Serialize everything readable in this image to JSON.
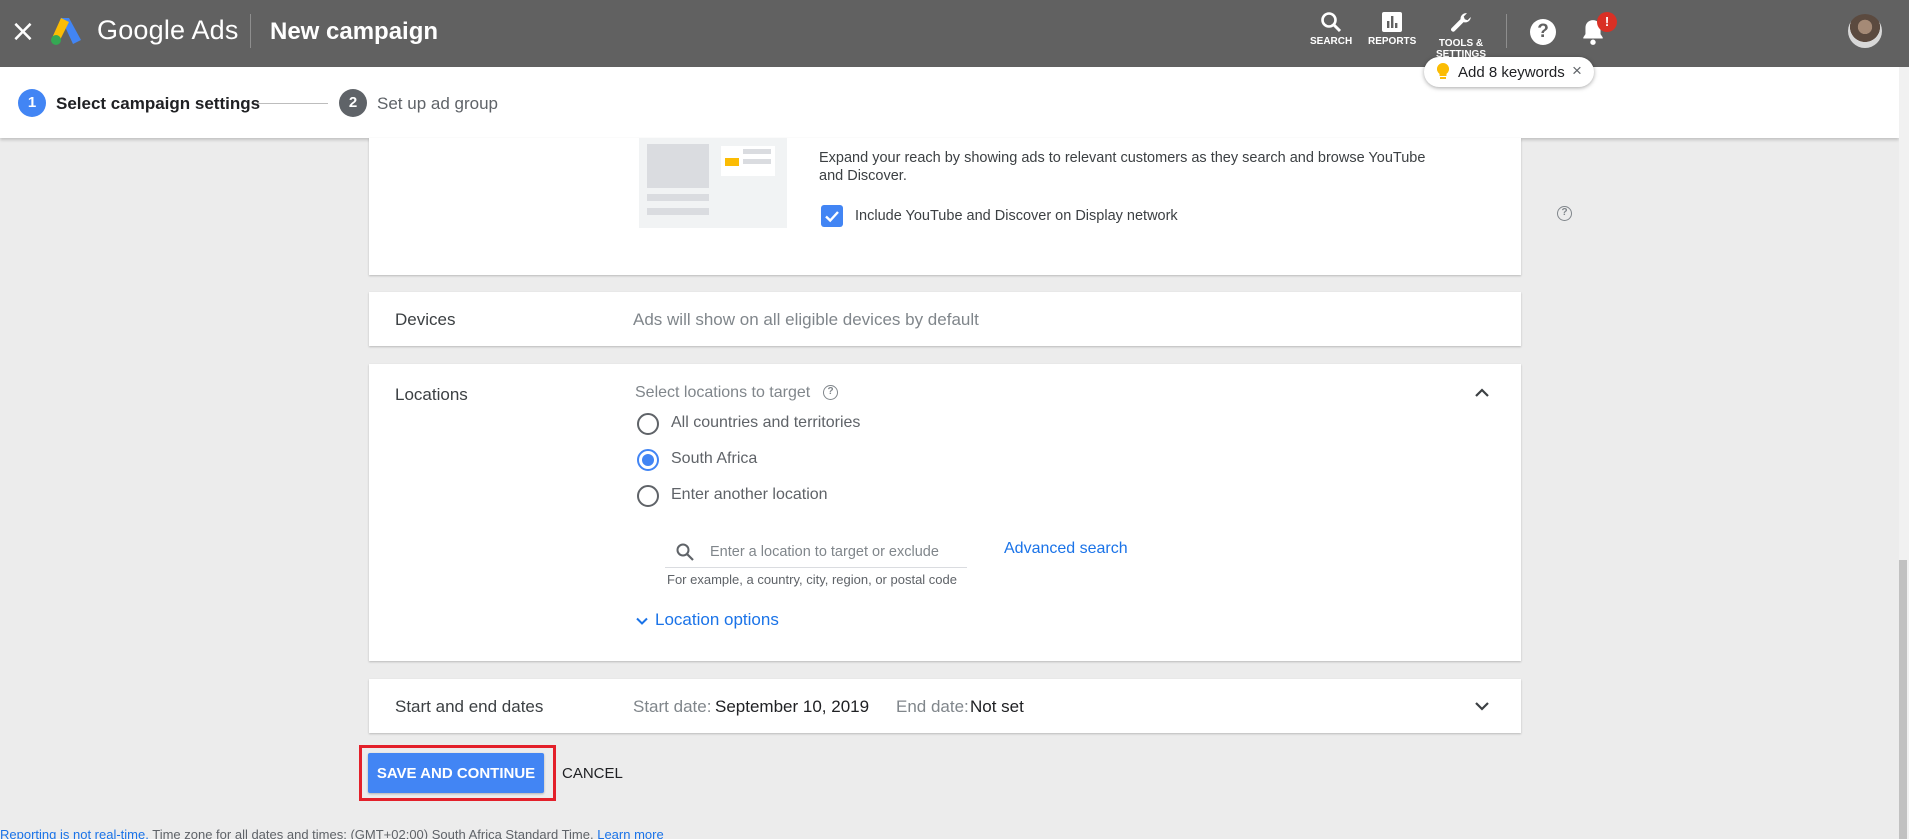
{
  "header": {
    "close_label": "×",
    "brand": "Google Ads",
    "page_title": "New campaign",
    "search_label": "SEARCH",
    "reports_label": "REPORTS",
    "tools_label_1": "TOOLS &",
    "tools_label_2": "SETTINGS",
    "help_label": "?",
    "notification_badge": "!"
  },
  "keyword_chip": {
    "text": "Add 8 keywords",
    "close_label": "×"
  },
  "stepper": {
    "step1_number": "1",
    "step1_label": "Select campaign settings",
    "step2_number": "2",
    "step2_label": "Set up ad group"
  },
  "networks": {
    "description": "Expand your reach by showing ads to relevant customers as they search and browse YouTube and Discover.",
    "checkbox_label": "Include YouTube and Discover on Display network",
    "checkbox_checked": true
  },
  "devices": {
    "label": "Devices",
    "summary": "Ads will show on all eligible devices by default"
  },
  "locations": {
    "label": "Locations",
    "prompt": "Select locations to target",
    "options": [
      {
        "label": "All countries and territories",
        "checked": false
      },
      {
        "label": "South Africa",
        "checked": true
      },
      {
        "label": "Enter another location",
        "checked": false
      }
    ],
    "search_placeholder": "Enter a location to target or exclude",
    "search_help": "For example, a country, city, region, or postal code",
    "advanced_search": "Advanced search",
    "location_options": "Location options"
  },
  "dates": {
    "label": "Start and end dates",
    "start_prefix": "Start date:",
    "start_value": "September 10, 2019",
    "end_prefix": "End date:",
    "end_value": "Not set"
  },
  "actions": {
    "save_label": "SAVE AND CONTINUE",
    "cancel_label": "CANCEL"
  },
  "footer": {
    "realtime_link": "Reporting is not real-time.",
    "timezone_text": "Time zone for all dates and times: (GMT+02:00) South Africa Standard Time.",
    "learn_more": "Learn more"
  },
  "colors": {
    "topbar": "#616161",
    "accent": "#4285f4",
    "link": "#1a73e8",
    "highlight": "#e3202a",
    "badge": "#d93025"
  }
}
